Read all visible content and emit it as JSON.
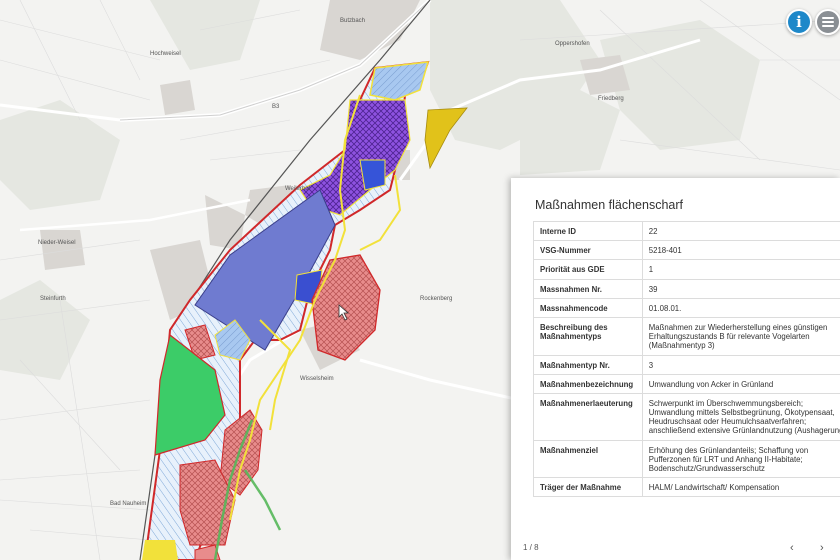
{
  "map": {
    "labels": [
      "Weilerhof",
      "Nieder-Weisel",
      "Butzbach",
      "Bad Nauheim",
      "Friedberg",
      "B3",
      "Rockenberg",
      "Oppershofen",
      "Wisselsheim",
      "Steinfurth",
      "Hochweisel"
    ]
  },
  "controls": {
    "info_icon_glyph": "i",
    "info_icon": "info-icon",
    "menu_icon": "hamburger-menu-icon"
  },
  "panel": {
    "title": "Maßnahmen flächenscharf",
    "rows": [
      {
        "key": "Interne ID",
        "value": "22"
      },
      {
        "key": "VSG-Nummer",
        "value": "5218-401"
      },
      {
        "key": "Priorität aus GDE",
        "value": "1"
      },
      {
        "key": "Massnahmen Nr.",
        "value": "39"
      },
      {
        "key": "Massnahmencode",
        "value": "01.08.01."
      },
      {
        "key": "Beschreibung des Maßnahmentyps",
        "value": "Maßnahmen zur Wiederherstellung eines günstigen\nErhaltungszustands B für relevante Vogelarten\n(Maßnahmentyp 3)"
      },
      {
        "key": "Maßnahmentyp Nr.",
        "value": "3"
      },
      {
        "key": "Maßnahmenbezeichnung",
        "value": "Umwandlung von Acker in Grünland"
      },
      {
        "key": "Maßnahmenerlaeuterung",
        "value": "Schwerpunkt im Überschwemmungsbereich;\nUmwandlung mittels Selbstbegrünung, Ökotypensaat,\nHeudruschsaat oder Heumulchsaatverfahren;\nanschließend extensive Grünlandnutzung (Aushagerung)"
      },
      {
        "key": "Maßnahmenziel",
        "value": "Erhöhung des Grünlandanteils; Schaffung von\nPufferzonen für LRT und Anhang II-Habitate;\nBodenschutz/Grundwasserschutz"
      },
      {
        "key": "Träger der Maßnahme",
        "value": "HALM/ Landwirtschaft/ Kompensation"
      }
    ],
    "pager": "1 / 8",
    "prev_label": "‹",
    "next_label": "›"
  }
}
